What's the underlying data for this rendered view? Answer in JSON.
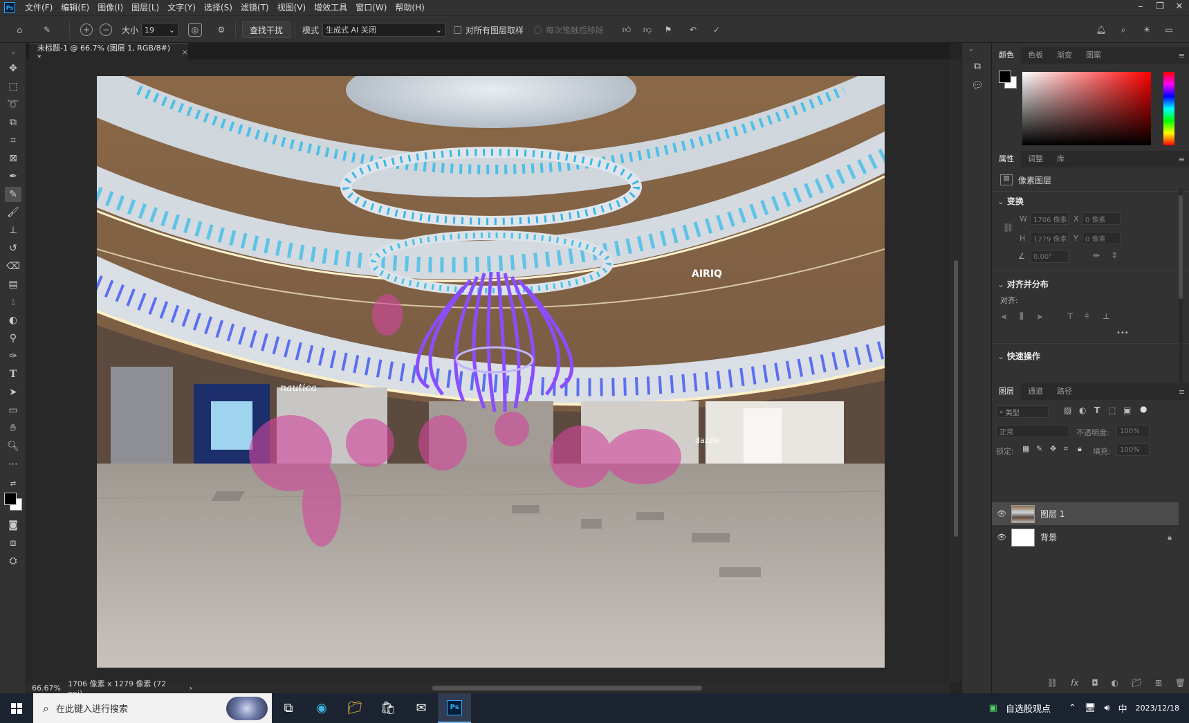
{
  "menu": {
    "items": [
      "文件(F)",
      "编辑(E)",
      "图像(I)",
      "图层(L)",
      "文字(Y)",
      "选择(S)",
      "滤镜(T)",
      "视图(V)",
      "增效工具",
      "窗口(W)",
      "帮助(H)"
    ],
    "logo_text": "Ps"
  },
  "options": {
    "size_label": "大小",
    "size_value": "19",
    "find_button": "查找干扰",
    "mode_label": "模式",
    "mode_value": "生成式 AI 关闭",
    "sample_all": "对所有图层取样",
    "remove_after": "每次笔触后移除"
  },
  "document": {
    "tab_title": "未标题-1 @ 66.7% (图层 1, RGB/8#) *",
    "close": "×"
  },
  "status": {
    "zoom": "66.67%",
    "info": "1706 像素 x 1279 像素 (72 ppi)",
    "arrow": "›"
  },
  "panels": {
    "color_tabs": [
      "颜色",
      "色板",
      "渐变",
      "图案"
    ],
    "props_tabs": [
      "属性",
      "调整",
      "库"
    ],
    "props_type": "像素图层",
    "transform_header": "变换",
    "w_label": "W",
    "w_value": "1706 像素",
    "h_label": "H",
    "h_value": "1279 像素",
    "x_label": "X",
    "x_value": "0 像素",
    "y_label": "Y",
    "y_value": "0 像素",
    "angle_value": "0.00°",
    "align_header": "对齐并分布",
    "align_label": "对齐:",
    "more": "•••",
    "quick_header": "快速操作",
    "layers_tabs": [
      "图层",
      "通道",
      "路径"
    ],
    "filter_placeholder": "类型",
    "blend_mode": "正常",
    "opacity_label": "不透明度:",
    "opacity_value": "100%",
    "lock_label": "锁定:",
    "fill_label": "填充:",
    "fill_value": "100%",
    "layers": [
      {
        "name": "图层 1",
        "selected": true
      },
      {
        "name": "背景",
        "selected": false
      }
    ]
  },
  "taskbar": {
    "search_placeholder": "在此键入进行搜索",
    "tray_app": "自选股观点",
    "ime": "中",
    "time": "2023/12/18"
  },
  "photo": {
    "sign_nautica": "nautica",
    "sign_airiq": "AIRIQ",
    "sign_dazzle": "dazzle"
  }
}
